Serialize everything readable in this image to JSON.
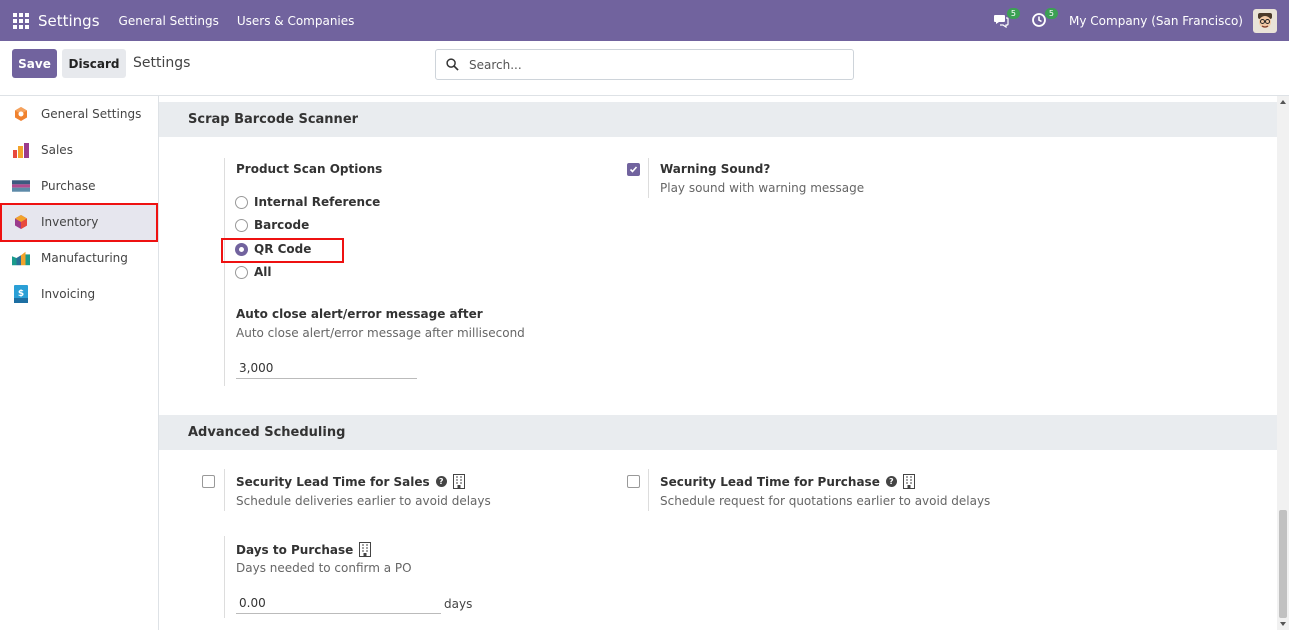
{
  "navbar": {
    "brand": "Settings",
    "menus": [
      "General Settings",
      "Users & Companies"
    ],
    "chat_badge": "5",
    "activity_badge": "5",
    "company": "My Company (San Francisco)"
  },
  "control_panel": {
    "save_label": "Save",
    "discard_label": "Discard",
    "title": "Settings",
    "search_placeholder": "Search..."
  },
  "sidebar": {
    "items": [
      {
        "label": "General Settings",
        "icon": "general-settings-icon"
      },
      {
        "label": "Sales",
        "icon": "sales-icon"
      },
      {
        "label": "Purchase",
        "icon": "purchase-icon"
      },
      {
        "label": "Inventory",
        "icon": "inventory-icon",
        "active": true
      },
      {
        "label": "Manufacturing",
        "icon": "manufacturing-icon"
      },
      {
        "label": "Invoicing",
        "icon": "invoicing-icon"
      }
    ]
  },
  "scrap_section": {
    "title": "Scrap Barcode Scanner",
    "product_scan": {
      "label": "Product Scan Options",
      "options": [
        "Internal Reference",
        "Barcode",
        "QR Code",
        "All"
      ],
      "selected": "QR Code"
    },
    "warning_sound": {
      "label": "Warning Sound?",
      "desc": "Play sound with warning message",
      "checked": true
    },
    "auto_close": {
      "label": "Auto close alert/error message after",
      "desc": "Auto close alert/error message after millisecond",
      "value": "3,000"
    }
  },
  "advanced_section": {
    "title": "Advanced Scheduling",
    "sales_lead": {
      "label": "Security Lead Time for Sales",
      "desc": "Schedule deliveries earlier to avoid delays",
      "checked": false
    },
    "purchase_lead": {
      "label": "Security Lead Time for Purchase",
      "desc": "Schedule request for quotations earlier to avoid delays",
      "checked": false
    },
    "days_to_purchase": {
      "label": "Days to Purchase",
      "desc": "Days needed to confirm a PO",
      "value": "0.00",
      "unit": "days"
    }
  },
  "colors": {
    "brand": "#71639e",
    "highlight_box": "#ee1111",
    "badge": "#3ca054"
  }
}
